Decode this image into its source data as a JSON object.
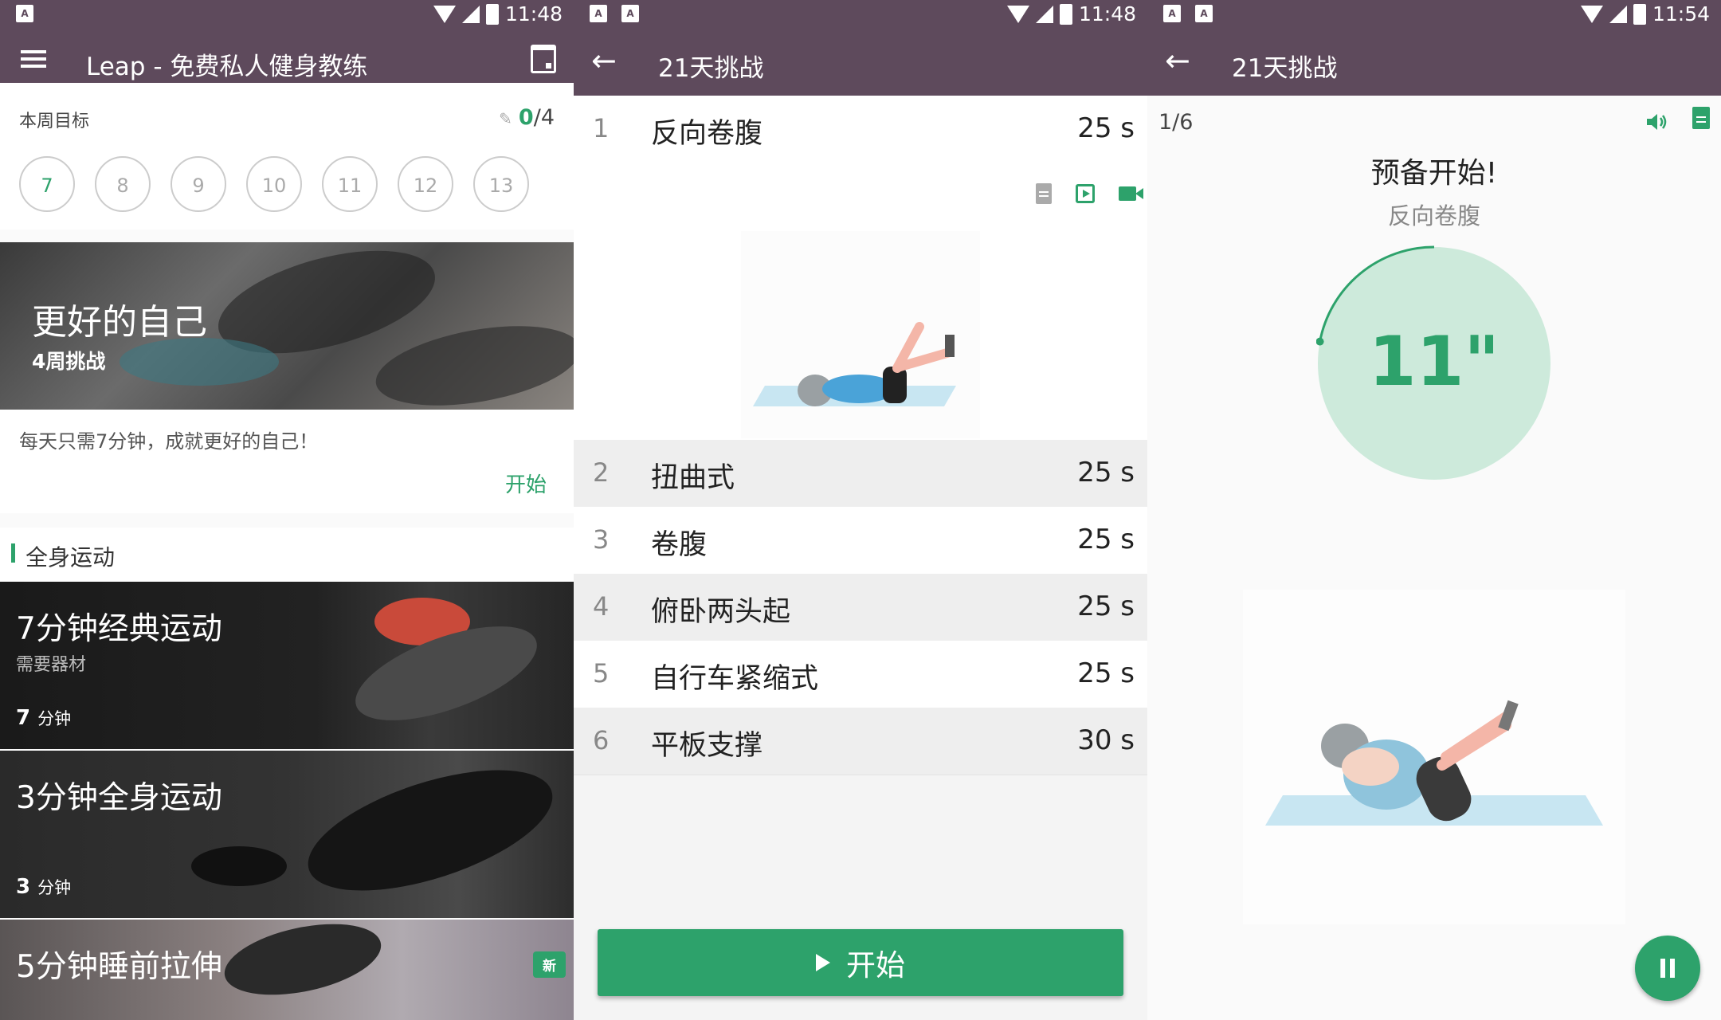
{
  "status_bars": [
    {
      "time": "11:48"
    },
    {
      "time": "11:48"
    },
    {
      "time": "11:54"
    }
  ],
  "home": {
    "title": "Leap - 免费私人健身教练",
    "weekly_goal": {
      "label": "本周目标",
      "done": "0",
      "total": "/4",
      "days": [
        "7",
        "8",
        "9",
        "10",
        "11",
        "12",
        "13"
      ]
    },
    "hero": {
      "title": "更好的自己",
      "subtitle": "4周挑战",
      "description": "每天只需7分钟，成就更好的自己！",
      "start_label": "开始"
    },
    "section_title": "全身运动",
    "workouts": [
      {
        "title": "7分钟经典运动",
        "subtitle": "需要器材",
        "duration_num": "7",
        "duration_unit": "分钟"
      },
      {
        "title": "3分钟全身运动",
        "subtitle": "",
        "duration_num": "3",
        "duration_unit": "分钟"
      },
      {
        "title": "5分钟睡前拉伸",
        "badge": "新"
      }
    ]
  },
  "plan": {
    "title": "21天挑战",
    "exercises": [
      {
        "num": "1",
        "name": "反向卷腹",
        "duration": "25 s"
      },
      {
        "num": "2",
        "name": "扭曲式",
        "duration": "25 s"
      },
      {
        "num": "3",
        "name": "卷腹",
        "duration": "25 s"
      },
      {
        "num": "4",
        "name": "俯卧两头起",
        "duration": "25 s"
      },
      {
        "num": "5",
        "name": "自行车紧缩式",
        "duration": "25 s"
      },
      {
        "num": "6",
        "name": "平板支撑",
        "duration": "30 s"
      }
    ],
    "start_label": "开始"
  },
  "workout": {
    "title": "21天挑战",
    "progress": "1/6",
    "ready": "预备开始!",
    "exercise_name": "反向卷腹",
    "countdown": "11\"",
    "countdown_fraction": 0.22
  },
  "colors": {
    "bar": "#5e4a5c",
    "accent": "#2da26b",
    "timer_fill": "#cdeadb"
  }
}
